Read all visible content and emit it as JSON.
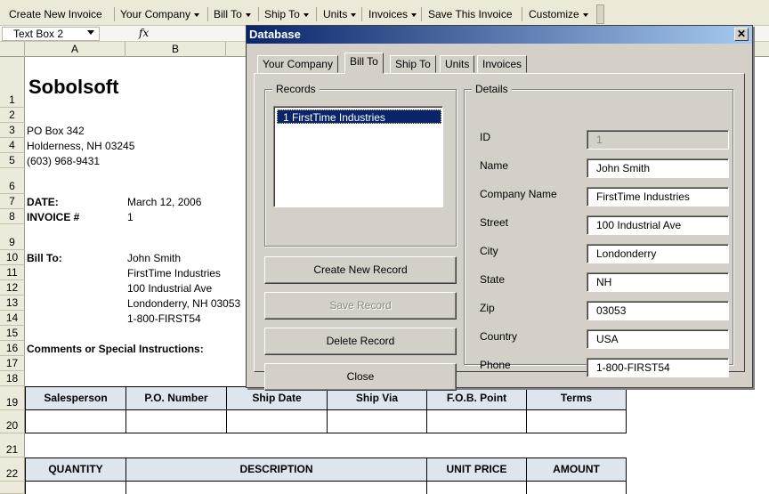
{
  "toolbar": {
    "items": [
      {
        "label": "Create New Invoice",
        "dropdown": false
      },
      {
        "label": "Your Company",
        "dropdown": true
      },
      {
        "label": "Bill To",
        "dropdown": true
      },
      {
        "label": "Ship To",
        "dropdown": true
      },
      {
        "label": "Units",
        "dropdown": true
      },
      {
        "label": "Invoices",
        "dropdown": true
      },
      {
        "label": "Save This Invoice",
        "dropdown": false
      },
      {
        "label": "Customize",
        "dropdown": true
      }
    ]
  },
  "formula_bar": {
    "name_box": "Text Box 2",
    "fx_symbol": "fx"
  },
  "sheet": {
    "columns": [
      "A",
      "B"
    ],
    "rows": [
      "1",
      "2",
      "3",
      "4",
      "5",
      "6",
      "7",
      "8",
      "9",
      "10",
      "11",
      "12",
      "13",
      "14",
      "15",
      "16",
      "17",
      "18",
      "19",
      "20",
      "21",
      "22"
    ],
    "company": "Sobolsoft",
    "address1": "PO Box 342",
    "address2": "Holderness, NH 03245",
    "phone": "(603) 968-9431",
    "date_label": "DATE:",
    "date_value": "March 12, 2006",
    "invoice_label": "INVOICE #",
    "invoice_value": "1",
    "billto_label": "Bill To:",
    "billto_lines": [
      "John Smith",
      "FirstTime Industries",
      "100 Industrial Ave",
      "Londonderry, NH 03053",
      "1-800-FIRST54"
    ],
    "comments_label": "Comments or Special Instructions:",
    "table1_headers": [
      "Salesperson",
      "P.O. Number",
      "Ship Date",
      "Ship Via",
      "F.O.B. Point",
      "Terms"
    ],
    "table2_headers": [
      "QUANTITY",
      "DESCRIPTION",
      "UNIT PRICE",
      "AMOUNT"
    ]
  },
  "dialog": {
    "title": "Database",
    "close_glyph": "✕",
    "tabs": [
      "Your Company",
      "Bill To",
      "Ship To",
      "Units",
      "Invoices"
    ],
    "active_tab": "Bill To",
    "records_label": "Records",
    "records": [
      "1 FirstTime Industries"
    ],
    "buttons": {
      "create": "Create New Record",
      "save": "Save Record",
      "delete": "Delete Record",
      "close": "Close"
    },
    "details_label": "Details",
    "fields": [
      {
        "label": "ID",
        "value": "1"
      },
      {
        "label": "Name",
        "value": "John Smith"
      },
      {
        "label": "Company Name",
        "value": "FirstTime Industries"
      },
      {
        "label": "Street",
        "value": "100 Industrial Ave"
      },
      {
        "label": "City",
        "value": "Londonderry"
      },
      {
        "label": "State",
        "value": "NH"
      },
      {
        "label": "Zip",
        "value": "03053"
      },
      {
        "label": "Country",
        "value": "USA"
      },
      {
        "label": "Phone",
        "value": "1-800-FIRST54"
      }
    ]
  },
  "colors": {
    "title_start": "#0a246a",
    "title_end": "#a6caf0",
    "table_header_bg": "#dde6ef"
  }
}
